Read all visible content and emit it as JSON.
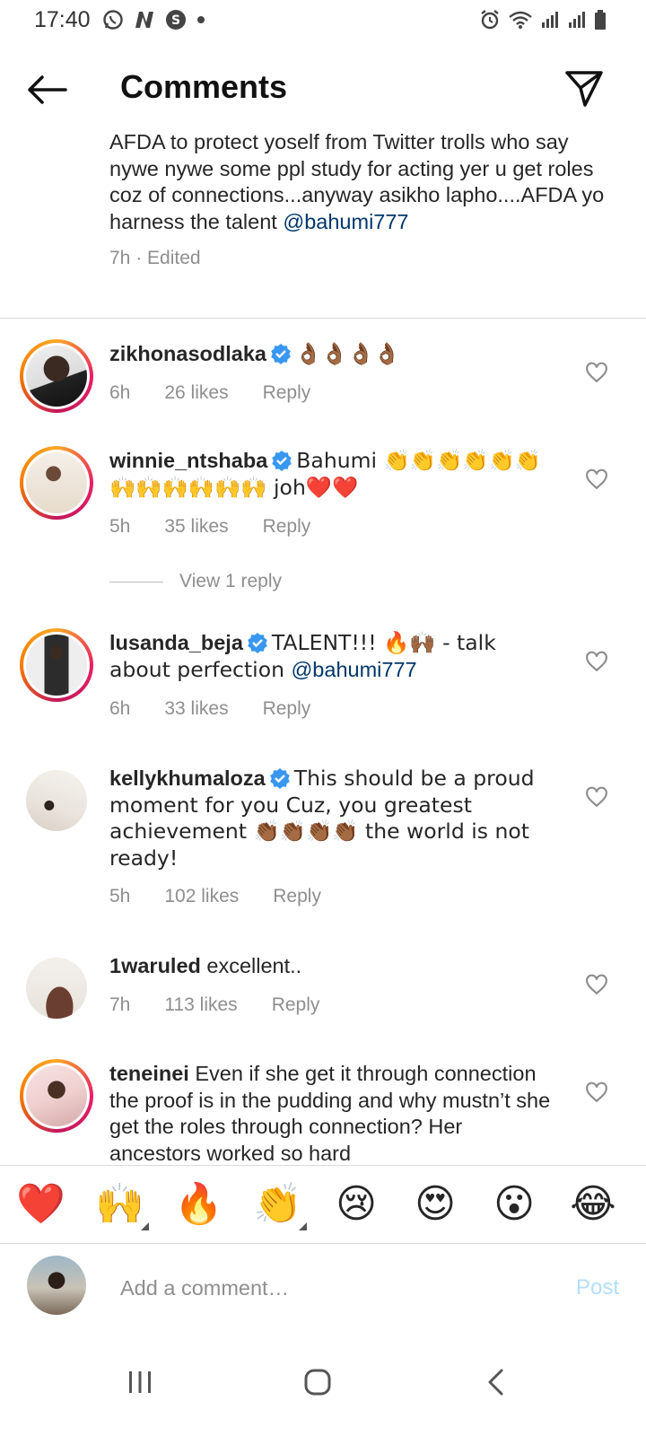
{
  "status_bar": {
    "time": "17:40",
    "left_icons": [
      "whatsapp-icon",
      "netflix-n-icon",
      "s-app-icon",
      "dot-icon"
    ],
    "right_icons": [
      "alarm-icon",
      "wifi-icon",
      "signal-1-icon",
      "signal-2-icon",
      "battery-icon"
    ]
  },
  "header": {
    "title": "Comments",
    "back_icon": "back-arrow-icon",
    "share_icon": "send-icon"
  },
  "caption": {
    "text": "AFDA to protect yoself from Twitter trolls who say nywe nywe some ppl study for acting yer u get roles coz of connections...anyway asikho lapho....AFDA yo harness the talent ",
    "mention": "@bahumi777",
    "meta": "7h · Edited"
  },
  "comments": [
    {
      "username": "zikhonasodlaka",
      "verified": true,
      "text": "👌🏾👌🏾👌🏾👌🏾",
      "time": "6h",
      "likes": "26 likes",
      "reply": "Reply"
    },
    {
      "username": "winnie_ntshaba",
      "verified": true,
      "text": "Bahumi 👏👏👏👏👏👏🙌🙌🙌🙌🙌🙌 joh❤️❤️",
      "time": "5h",
      "likes": "35 likes",
      "reply": "Reply"
    },
    {
      "username": "lusanda_beja",
      "verified": true,
      "text": "TALENT!!! 🔥🙌🏾 - talk about perfection ",
      "mention": "@bahumi777",
      "time": "6h",
      "likes": "33 likes",
      "reply": "Reply"
    },
    {
      "username": "kellykhumaloza",
      "verified": true,
      "text": "This should be a proud moment for you Cuz, you greatest achievement 👏🏾👏🏾👏🏾👏🏾 the world is not ready!",
      "time": "5h",
      "likes": "102 likes",
      "reply": "Reply"
    },
    {
      "username": "1waruled",
      "verified": false,
      "text": "excellent..",
      "time": "7h",
      "likes": "113 likes",
      "reply": "Reply"
    },
    {
      "username": "teneinei",
      "verified": false,
      "text": "Even if she get it through connection the proof is in the pudding and why mustn’t she get the roles through connection? Her ancestors worked so hard"
    }
  ],
  "view_replies": "View 1 reply",
  "quick_emojis": [
    "❤️",
    "🙌",
    "🔥",
    "👏",
    "😢",
    "😍",
    "😮",
    "😂"
  ],
  "composer": {
    "placeholder": "Add a comment…",
    "post_label": "Post"
  },
  "nav": {
    "icons": [
      "recents-icon",
      "home-icon",
      "back-icon"
    ]
  },
  "colors": {
    "mention": "#00376b",
    "muted": "#8e8e8e",
    "verified": "#3897f0",
    "post_disabled": "#b2dffc"
  }
}
